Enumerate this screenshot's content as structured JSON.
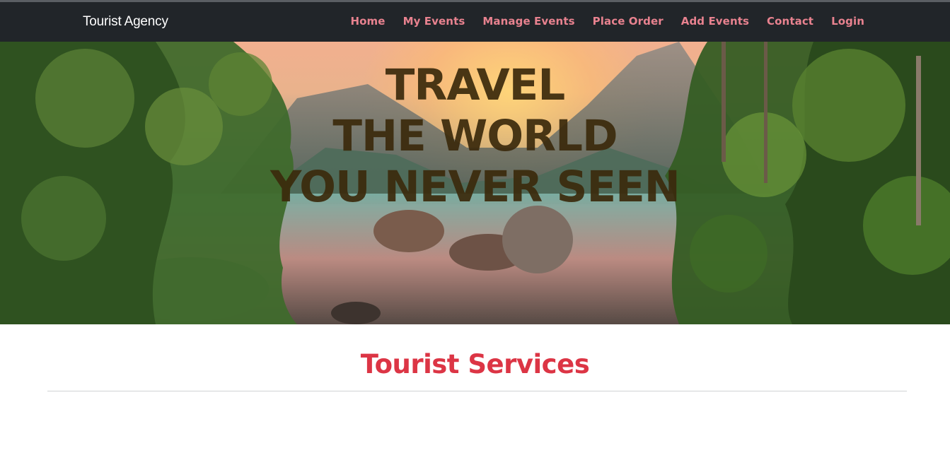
{
  "navbar": {
    "brand": "Tourist Agency",
    "links": [
      "Home",
      "My Events",
      "Manage Events",
      "Place Order",
      "Add Events",
      "Contact",
      "Login"
    ],
    "link_color": "#e8828f",
    "background": "#212529"
  },
  "hero": {
    "line1": "TRAVEL",
    "line2": "THE WORLD",
    "line3": "YOU NEVER SEEN",
    "text_color": "#3b2a0c"
  },
  "services": {
    "title": "Tourist Services",
    "title_color": "#dc3545"
  }
}
